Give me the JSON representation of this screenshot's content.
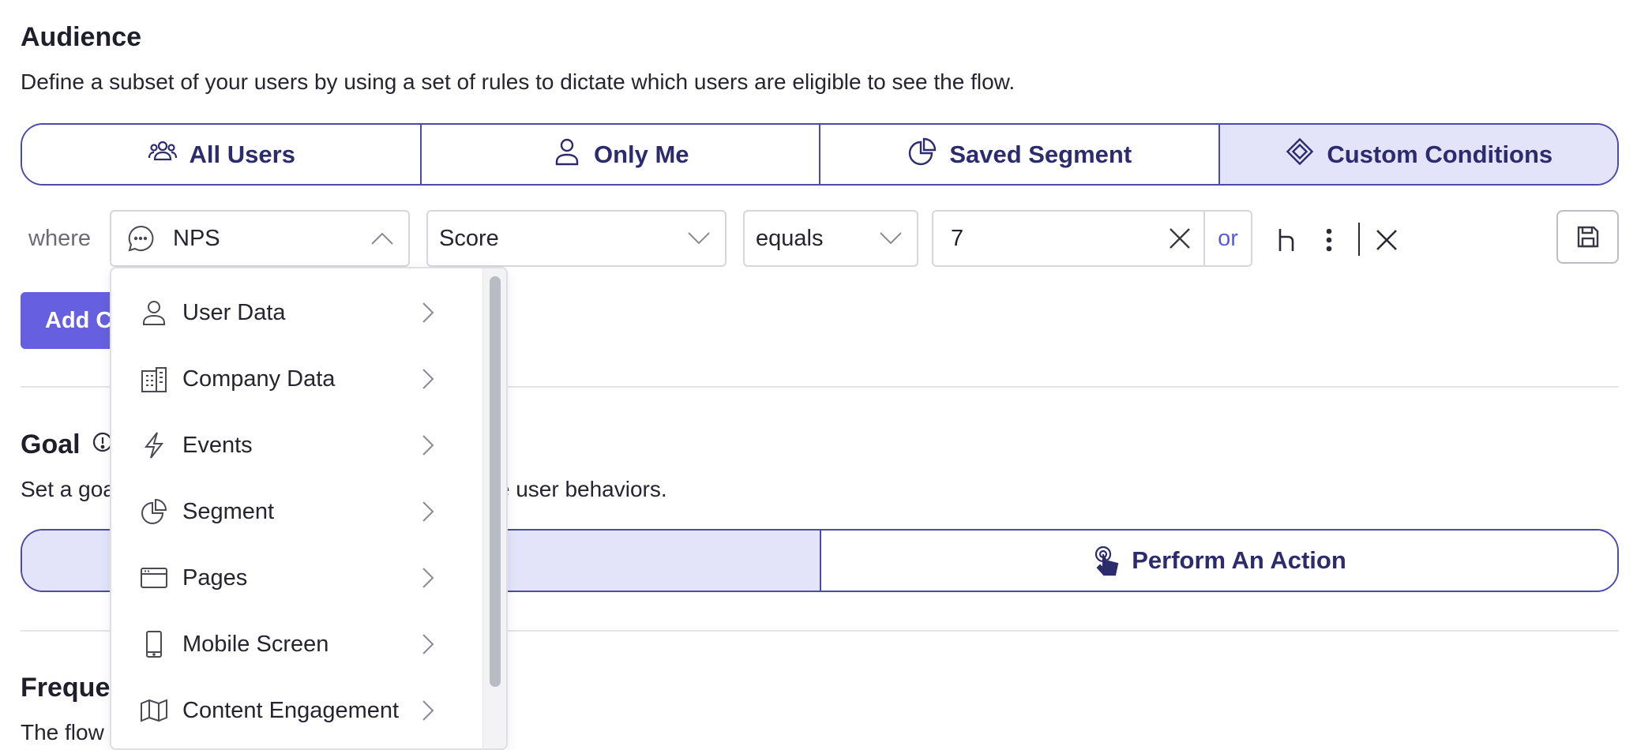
{
  "audience": {
    "title": "Audience",
    "description": "Define a subset of your users by using a set of rules to dictate which users are eligible to see the flow.",
    "options": [
      {
        "label": "All Users",
        "icon": "users-icon"
      },
      {
        "label": "Only Me",
        "icon": "user-icon"
      },
      {
        "label": "Saved Segment",
        "icon": "pie-chart-icon"
      },
      {
        "label": "Custom Conditions",
        "icon": "diamond-icon",
        "selected": true
      }
    ]
  },
  "condition": {
    "where_label": "where",
    "source": {
      "value": "NPS",
      "icon": "chat-bubble-icon",
      "open": true
    },
    "property": {
      "value": "Score"
    },
    "operator": {
      "value": "equals"
    },
    "value": "7",
    "or_label": "or"
  },
  "add_condition_label": "Add Condition",
  "goal": {
    "title": "Goal",
    "description": "Set a goal to measure how your flow will influence user behaviors.",
    "options": [
      {
        "label": "",
        "selected": true
      },
      {
        "label": "Perform An Action",
        "icon": "tap-icon"
      }
    ]
  },
  "frequency": {
    "title": "Frequency",
    "description": "The flow will be shown"
  },
  "dropdown": {
    "items": [
      {
        "label": "User Data",
        "icon": "user-icon"
      },
      {
        "label": "Company Data",
        "icon": "building-icon"
      },
      {
        "label": "Events",
        "icon": "lightning-icon"
      },
      {
        "label": "Segment",
        "icon": "pie-chart-icon"
      },
      {
        "label": "Pages",
        "icon": "browser-window-icon"
      },
      {
        "label": "Mobile Screen",
        "icon": "mobile-icon"
      },
      {
        "label": "Content Engagement",
        "icon": "map-icon"
      }
    ]
  },
  "colors": {
    "accent": "#6660e0",
    "selected_bg": "#e3e3fa",
    "border_accent": "#4b4ba8",
    "text_dark": "#25252f"
  }
}
